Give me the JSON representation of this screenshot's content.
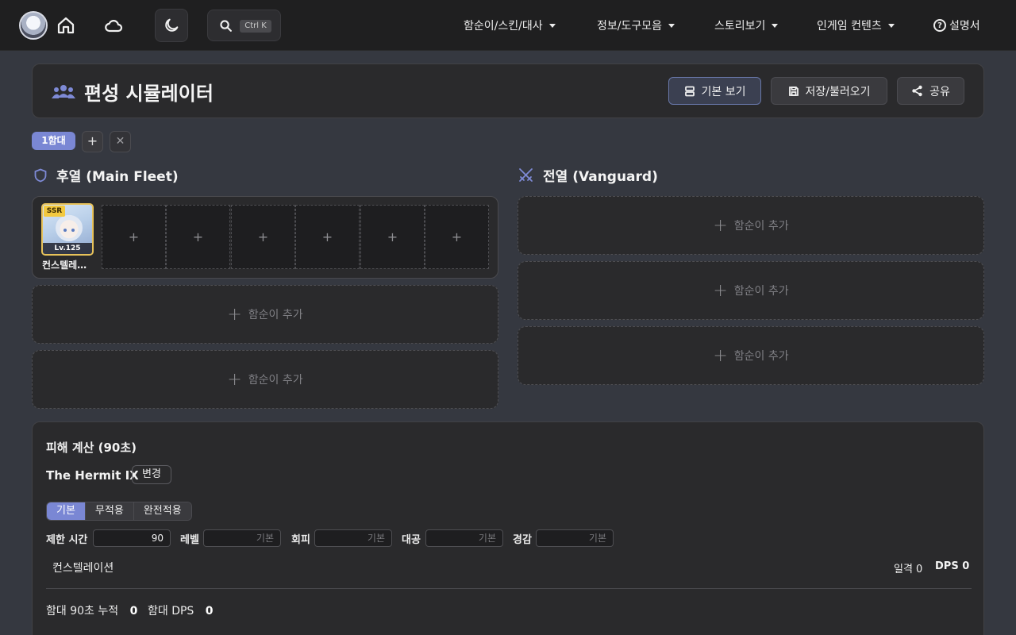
{
  "nav": {
    "search_shortcut": "Ctrl K",
    "menus": [
      "함순이/스킨/대사",
      "정보/도구모음",
      "스토리보기",
      "인게임 컨텐츠"
    ],
    "help": "설명서"
  },
  "header": {
    "title": "편성 시뮬레이터",
    "view_button": "기본 보기",
    "save_button": "저장/불러오기",
    "share_button": "공유"
  },
  "fleet_tabs": {
    "active": "1함대",
    "add": "+",
    "remove": "✕"
  },
  "main_fleet": {
    "title": "후열 (Main Fleet)",
    "ship": {
      "rarity": "SSR",
      "level": "Lv.125",
      "name": "컨스텔레이션"
    },
    "empty_slot": "+",
    "add_label": "함순이 추가"
  },
  "vanguard": {
    "title": "전열 (Vanguard)",
    "add_label": "함순이 추가"
  },
  "damage": {
    "title": "피해 계산 (90초)",
    "enemy": "The Hermit IX",
    "change": "변경",
    "modes": [
      "기본",
      "무적용",
      "완전적용"
    ],
    "active_mode": "기본",
    "fields": {
      "time_label": "제한 시간",
      "time_value": "90",
      "level_label": "레벨",
      "level_ph": "기본",
      "evasion_label": "회피",
      "evasion_ph": "기본",
      "aa_label": "대공",
      "aa_ph": "기본",
      "armor_label": "경감",
      "armor_ph": "기본"
    },
    "row": {
      "ship": "컨스텔레이션",
      "hits": "일격 0",
      "dps": "DPS 0"
    },
    "totals": {
      "cumulative_label": "함대 90초 누적",
      "cumulative_value": "0",
      "dps_label": "함대 DPS",
      "dps_value": "0"
    }
  },
  "colors": {
    "accent": "#7a87d4",
    "ssr": "#f3c93f",
    "background": "#353840"
  }
}
